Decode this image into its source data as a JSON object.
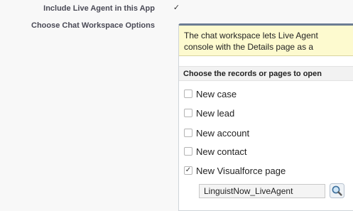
{
  "form": {
    "include_label": "Include Live Agent in this App",
    "include_checked": true,
    "workspace_label": "Choose Chat Workspace Options"
  },
  "panel": {
    "info_line1": "The chat workspace lets Live Agent",
    "info_line2": "console with the Details page as a",
    "section_title": "Choose the records or pages to open",
    "options": [
      {
        "label": "New case",
        "checked": false
      },
      {
        "label": "New lead",
        "checked": false
      },
      {
        "label": "New account",
        "checked": false
      },
      {
        "label": "New contact",
        "checked": false
      },
      {
        "label": "New Visualforce page",
        "checked": true
      }
    ],
    "visualforce_page_value": "LinguistNow_LiveAgent",
    "lookup_icon": "magnifier-icon"
  }
}
